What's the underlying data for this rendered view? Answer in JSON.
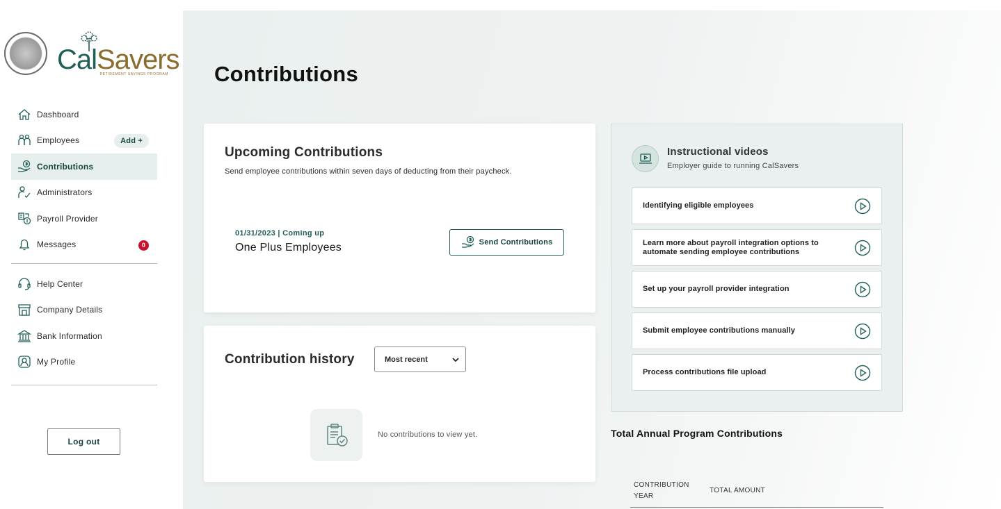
{
  "brand": {
    "name_part1": "Cal",
    "name_part2": "Savers",
    "tagline": "RETIREMENT SAVINGS PROGRAM"
  },
  "sidebar": {
    "items": [
      {
        "label": "Dashboard",
        "icon": "home-icon"
      },
      {
        "label": "Employees",
        "icon": "people-icon",
        "pill": "Add +"
      },
      {
        "label": "Contributions",
        "icon": "hand-dollar-icon",
        "active": true
      },
      {
        "label": "Administrators",
        "icon": "admin-icon"
      },
      {
        "label": "Payroll Provider",
        "icon": "payroll-icon"
      },
      {
        "label": "Messages",
        "icon": "bell-icon",
        "badge": "0"
      }
    ],
    "secondary": [
      {
        "label": "Help Center",
        "icon": "headset-icon"
      },
      {
        "label": "Company Details",
        "icon": "store-icon"
      },
      {
        "label": "Bank Information",
        "icon": "bank-icon"
      },
      {
        "label": "My Profile",
        "icon": "profile-icon"
      }
    ],
    "logout": "Log out"
  },
  "page": {
    "title": "Contributions"
  },
  "upcoming": {
    "title": "Upcoming Contributions",
    "subtitle": "Send employee contributions within seven days of deducting from their paycheck.",
    "date_status": "01/31/2023 | Coming up",
    "employer": "One Plus Employees",
    "send_button": "Send Contributions"
  },
  "history": {
    "title": "Contribution history",
    "sort_selected": "Most recent",
    "empty_text": "No contributions to view yet."
  },
  "videos": {
    "title": "Instructional videos",
    "subtitle": "Employer guide to running CalSavers",
    "items": [
      "Identifying eligible employees",
      "Learn more about payroll integration options to automate sending employee contributions",
      "Set up your payroll provider integration",
      "Submit employee contributions manually",
      "Process contributions file upload"
    ]
  },
  "totals": {
    "title": "Total Annual Program Contributions",
    "col_year": "CONTRIBUTION YEAR",
    "col_amount": "TOTAL AMOUNT"
  },
  "colors": {
    "brand_green": "#1f5f57",
    "brand_gold": "#8a6d2c",
    "badge_red": "#c8102e",
    "active_bg": "#e6efee"
  }
}
